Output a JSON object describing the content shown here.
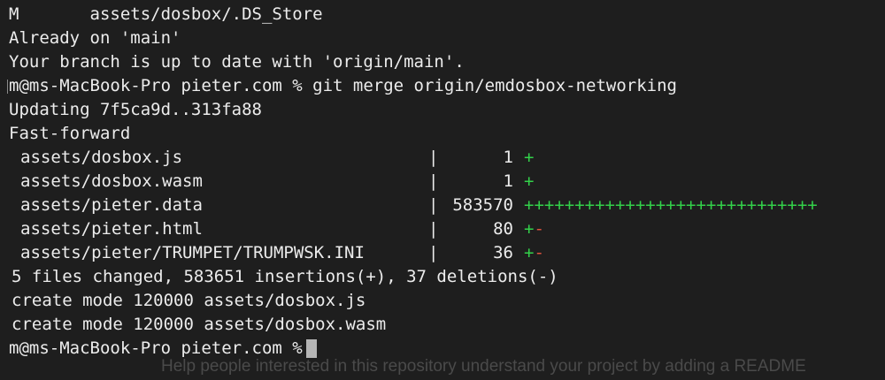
{
  "terminal": {
    "lines": [
      "M       assets/dosbox/.DS_Store",
      "Already on 'main'",
      "Your branch is up to date with 'origin/main'."
    ],
    "prompt_command": "m@ms-MacBook-Pro pieter.com % git merge origin/emdosbox-networking",
    "updating": "Updating 7f5ca9d..313fa88",
    "fast_forward": "Fast-forward",
    "stat_rows": [
      {
        "file": "assets/dosbox.js",
        "sep": "|",
        "count": "1",
        "plus": "+",
        "minus": ""
      },
      {
        "file": "assets/dosbox.wasm",
        "sep": "|",
        "count": "1",
        "plus": "+",
        "minus": ""
      },
      {
        "file": "assets/pieter.data",
        "sep": "|",
        "count": "583570",
        "plus": "+++++++++++++++++++++++++++++",
        "minus": ""
      },
      {
        "file": "assets/pieter.html",
        "sep": "|",
        "count": "80",
        "plus": "+",
        "minus": "-"
      },
      {
        "file": "assets/pieter/TRUMPET/TRUMPWSK.INI",
        "sep": "|",
        "count": "36",
        "plus": "+",
        "minus": "-"
      }
    ],
    "summary": "5 files changed, 583651 insertions(+), 37 deletions(-)",
    "create_lines": [
      "create mode 120000 assets/dosbox.js",
      "create mode 120000 assets/dosbox.wasm"
    ],
    "final_prompt": "m@ms-MacBook-Pro pieter.com %",
    "background_text": "Help people interested in this repository understand your project by adding a README",
    "colors": {
      "background": "#1e1e1e",
      "text": "#ececec",
      "plus": "#33d14a",
      "minus": "#e0533f"
    }
  }
}
